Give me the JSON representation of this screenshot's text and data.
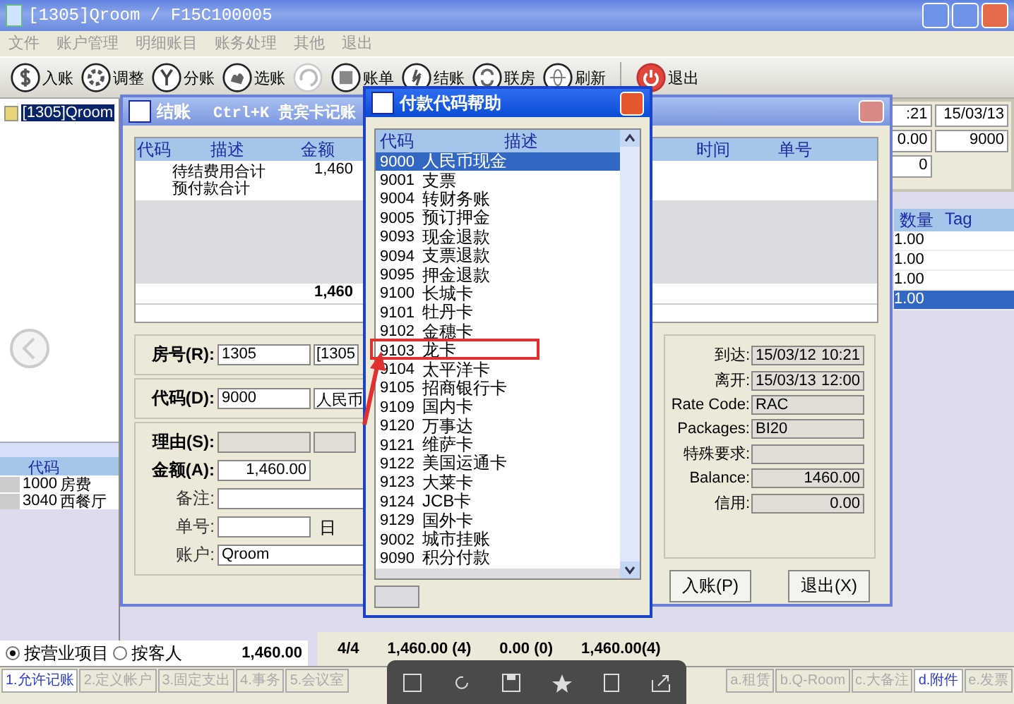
{
  "window": {
    "title": "[1305]Qroom / F15C100005"
  },
  "menu": [
    {
      "label": "文件",
      "disabled": true
    },
    {
      "label": "账户管理",
      "disabled": true
    },
    {
      "label": "明细账目",
      "disabled": true
    },
    {
      "label": "账务处理",
      "disabled": true
    },
    {
      "label": "其他",
      "disabled": true
    },
    {
      "label": "退出",
      "disabled": true
    }
  ],
  "toolbar": [
    {
      "kind": "dollar",
      "label": "入账",
      "disabled": false
    },
    {
      "kind": "gear",
      "label": "调整",
      "disabled": false
    },
    {
      "kind": "split",
      "label": "分账",
      "disabled": false
    },
    {
      "kind": "hand",
      "label": "选账",
      "disabled": false
    },
    {
      "kind": "cycle",
      "disabled": true
    },
    {
      "kind": "doc",
      "label": "账单",
      "disabled": false
    },
    {
      "kind": "person",
      "label": "结账",
      "disabled": false
    },
    {
      "kind": "link",
      "label": "联房",
      "disabled": false
    },
    {
      "kind": "globe",
      "label": "刷新",
      "disabled": false
    },
    {
      "kind": "power",
      "label": "退出",
      "disabled": false
    }
  ],
  "left_panel": {
    "tree": [
      {
        "label": "[1305]Qroom",
        "selected": true
      }
    ],
    "grid": {
      "columns": [
        "代码"
      ],
      "rows": [
        {
          "code": "1000",
          "name": "房费"
        },
        {
          "code": "3040",
          "name": "西餐厅"
        }
      ]
    },
    "radios": [
      {
        "label": "按营业项目",
        "selected": true
      },
      {
        "label": "按客人",
        "selected": false
      }
    ],
    "total": "1,460.00"
  },
  "background_info": {
    "fields": [
      ":21",
      "15/03/13",
      "0.00",
      "9000",
      "0"
    ]
  },
  "background_grid": {
    "columns": [
      "数量",
      "Tag"
    ],
    "rows": [
      {
        "qty": "1.00",
        "selected": false
      },
      {
        "qty": "1.00",
        "selected": false
      },
      {
        "qty": "1.00",
        "selected": false
      },
      {
        "qty": "1.00",
        "selected": true
      }
    ]
  },
  "summary": {
    "count": "4/4",
    "total": "1,460.00 (4)",
    "paid": "0.00 (0)",
    "balance": "1,460.00(4)"
  },
  "bottom_tabs": [
    {
      "label": "1.允许记账",
      "active": true
    },
    {
      "label": "2.定义帐户",
      "active": false
    },
    {
      "label": "3.固定支出",
      "active": false
    },
    {
      "label": "4.事务",
      "active": false
    },
    {
      "label": "5.会议室",
      "active": false
    },
    {
      "label": "a.租赁",
      "active": false
    },
    {
      "label": "b.Q-Room",
      "active": false
    },
    {
      "label": "c.大备注",
      "active": false
    },
    {
      "label": "d.附件",
      "active": true
    },
    {
      "label": "e.发票",
      "active": false
    }
  ],
  "checkout_dialog": {
    "title": "结账",
    "shortcut": "Ctrl+K 贵宾卡记账",
    "columns": [
      "代码",
      "描述",
      "金额",
      "时间",
      "单号"
    ],
    "rows": [
      {
        "description": "待结费用合计",
        "amount": "1,460"
      },
      {
        "description": "预付款合计"
      }
    ],
    "total": "1,460",
    "form": [
      {
        "label": "房号(R):",
        "value": "1305",
        "extra": "[1305",
        "bold": true,
        "disabled": false
      },
      {
        "label": "代码(D):",
        "value": "9000",
        "extra": "人民币",
        "bold": true,
        "disabled": false
      },
      {
        "label": "理由(S):",
        "bold": true,
        "disabled": true
      },
      {
        "label": "金额(A):",
        "value": "1,460.00",
        "bold": true,
        "disabled": false
      },
      {
        "label": "备注:",
        "bold": false,
        "disabled": false
      },
      {
        "label": "单号:",
        "extra": "日",
        "bold": false,
        "disabled": false
      },
      {
        "label": "账户:",
        "value": "Qroom",
        "bold": false,
        "disabled": false
      }
    ],
    "info": [
      {
        "label": "到达:",
        "value": "15/03/12",
        "time": "10:21",
        "numeric": false
      },
      {
        "label": "离开:",
        "value": "15/03/13",
        "time": "12:00",
        "numeric": false
      },
      {
        "label": "Rate Code:",
        "value": "RAC",
        "numeric": false
      },
      {
        "label": "Packages:",
        "value": "BI20",
        "numeric": false
      },
      {
        "label": "特殊要求:"
      },
      {
        "label": "Balance:",
        "value": "1460.00",
        "numeric": true
      },
      {
        "label": "信用:",
        "value": "0.00",
        "numeric": true
      }
    ],
    "buttons": [
      "入账(P)",
      "退出(X)"
    ]
  },
  "payment_popup": {
    "title": "付款代码帮助",
    "columns": [
      "代码",
      "描述"
    ],
    "rows": [
      {
        "code": "9000",
        "description": "人民币现金",
        "selected": true,
        "annotated": false
      },
      {
        "code": "9001",
        "description": "支票",
        "selected": false,
        "annotated": false
      },
      {
        "code": "9004",
        "description": "转财务账",
        "selected": false,
        "annotated": false
      },
      {
        "code": "9005",
        "description": "预订押金",
        "selected": false,
        "annotated": false
      },
      {
        "code": "9093",
        "description": "现金退款",
        "selected": false,
        "annotated": false
      },
      {
        "code": "9094",
        "description": "支票退款",
        "selected": false,
        "annotated": false
      },
      {
        "code": "9095",
        "description": "押金退款",
        "selected": false,
        "annotated": false
      },
      {
        "code": "9100",
        "description": "长城卡",
        "selected": false,
        "annotated": false
      },
      {
        "code": "9101",
        "description": "牡丹卡",
        "selected": false,
        "annotated": false
      },
      {
        "code": "9102",
        "description": "金穗卡",
        "selected": false,
        "annotated": false
      },
      {
        "code": "9103",
        "description": "龙卡",
        "selected": false,
        "annotated": true
      },
      {
        "code": "9104",
        "description": "太平洋卡",
        "selected": false,
        "annotated": false
      },
      {
        "code": "9105",
        "description": "招商银行卡",
        "selected": false,
        "annotated": false
      },
      {
        "code": "9109",
        "description": "国内卡",
        "selected": false,
        "annotated": false
      },
      {
        "code": "9120",
        "description": "万事达",
        "selected": false,
        "annotated": false
      },
      {
        "code": "9121",
        "description": "维萨卡",
        "selected": false,
        "annotated": false
      },
      {
        "code": "9122",
        "description": "美国运通卡",
        "selected": false,
        "annotated": false
      },
      {
        "code": "9123",
        "description": "大莱卡",
        "selected": false,
        "annotated": false
      },
      {
        "code": "9124",
        "description": "JCB卡",
        "selected": false,
        "annotated": false
      },
      {
        "code": "9129",
        "description": "国外卡",
        "selected": false,
        "annotated": false
      },
      {
        "code": "9002",
        "description": "城市挂账",
        "selected": false,
        "annotated": false
      },
      {
        "code": "9090",
        "description": "积分付款",
        "selected": false,
        "annotated": false
      }
    ]
  }
}
